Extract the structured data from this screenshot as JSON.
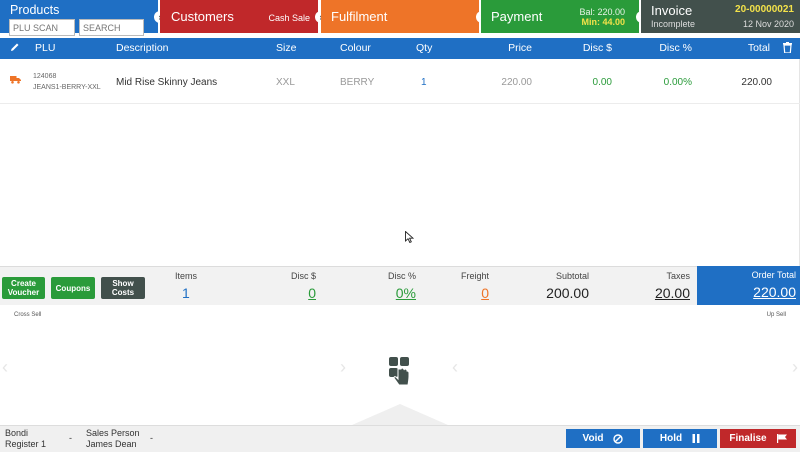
{
  "tiles": {
    "products": {
      "title": "Products",
      "plu_placeholder": "PLU SCAN",
      "search_placeholder": "SEARCH"
    },
    "customers": {
      "title": "Customers",
      "sub": "Cash Sale"
    },
    "fulfilment": {
      "title": "Fulfilment"
    },
    "payment": {
      "title": "Payment",
      "bal_label": "Bal:",
      "bal_value": "220.00",
      "min_label": "Min:",
      "min_value": "44.00"
    },
    "invoice": {
      "title": "Invoice",
      "number": "20-00000021",
      "status": "Incomplete",
      "date": "12 Nov 2020"
    }
  },
  "table": {
    "headers": {
      "plu": "PLU",
      "description": "Description",
      "size": "Size",
      "colour": "Colour",
      "qty": "Qty",
      "price": "Price",
      "disc_amt": "Disc $",
      "disc_pct": "Disc %",
      "total": "Total"
    },
    "rows": [
      {
        "plu_code": "124068",
        "plu_sku": "JEANS1-BERRY-XXL",
        "description": "Mid Rise Skinny Jeans",
        "size": "XXL",
        "colour": "BERRY",
        "qty": "1",
        "price": "220.00",
        "disc_amt": "0.00",
        "disc_pct": "0.00%",
        "total": "220.00"
      }
    ]
  },
  "actions": {
    "create_voucher_1": "Create",
    "create_voucher_2": "Voucher",
    "coupons": "Coupons",
    "show_costs_1": "Show",
    "show_costs_2": "Costs"
  },
  "totals": {
    "items_label": "Items",
    "items": "1",
    "disc_amt_label": "Disc $",
    "disc_amt": "0",
    "disc_pct_label": "Disc %",
    "disc_pct": "0%",
    "freight_label": "Freight",
    "freight": "0",
    "subtotal_label": "Subtotal",
    "subtotal": "200.00",
    "taxes_label": "Taxes",
    "taxes": "20.00",
    "order_total_label": "Order Total",
    "order_total": "220.00"
  },
  "cross_sell": {
    "left_label": "Cross Sell",
    "right_label": "Up Sell"
  },
  "footer": {
    "store": "Bondi",
    "register": "Register 1",
    "dash1": "-",
    "sales_person_label": "Sales Person",
    "sales_person": "James Dean",
    "dash2": "-",
    "void": "Void",
    "hold": "Hold",
    "finalise": "Finalise"
  },
  "colors": {
    "blue": "#1f6fc4",
    "red": "#c0282a",
    "orange": "#ee7428",
    "green": "#2a9b3a",
    "dark": "#42504c"
  },
  "icons": {
    "edit": "pencil-icon",
    "trash": "trash-icon",
    "truck": "truck-icon",
    "void": "cancel-circle-icon",
    "hold": "pause-icon",
    "finalise": "flag-icon",
    "touch": "touch-hand-icon"
  }
}
